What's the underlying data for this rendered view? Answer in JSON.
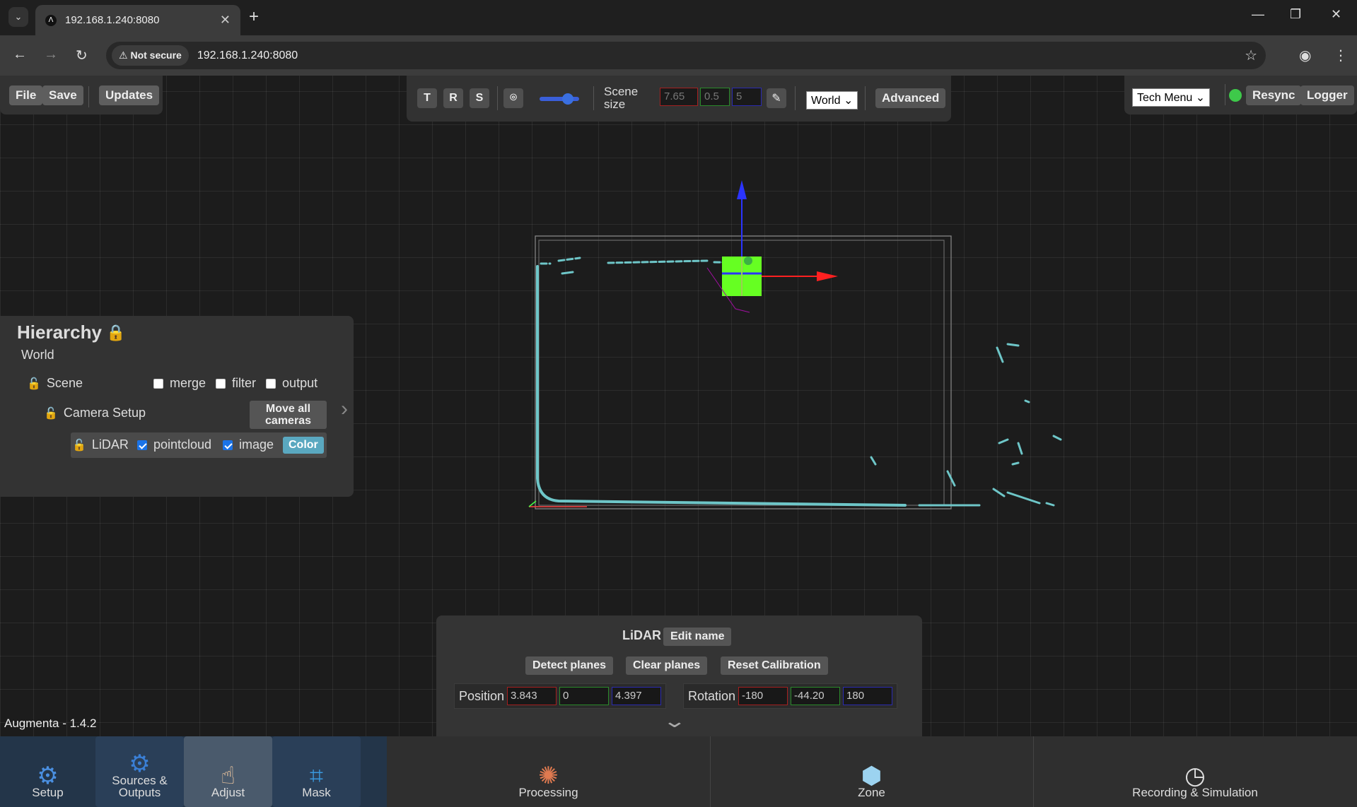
{
  "browser": {
    "tab_title": "192.168.1.240:8080",
    "not_secure": "Not secure",
    "url": "192.168.1.240:8080"
  },
  "toolbar_left": {
    "file": "File",
    "save": "Save",
    "updates": "Updates"
  },
  "toolbar_center": {
    "t": "T",
    "r": "R",
    "s": "S",
    "slider_value": 0.7,
    "scene_size_label": "Scene size",
    "scene_x": "7.65",
    "scene_y": "0.5",
    "scene_z": "5",
    "space_select": "World",
    "advanced": "Advanced"
  },
  "toolbar_right": {
    "tech_menu": "Tech Menu",
    "resync": "Resync",
    "logger": "Logger",
    "status_color": "#3ec94a"
  },
  "hierarchy": {
    "title": "Hierarchy",
    "world": "World",
    "scene": "Scene",
    "merge": "merge",
    "filter": "filter",
    "output": "output",
    "camera_setup": "Camera Setup",
    "move_all_line1": "Move all",
    "move_all_line2": "cameras",
    "lidar": "LiDAR",
    "pointcloud": "pointcloud",
    "image": "image",
    "color": "Color"
  },
  "version": "Augmenta - 1.4.2",
  "inspector": {
    "name": "LiDAR",
    "edit_name": "Edit name",
    "detect_planes": "Detect planes",
    "clear_planes": "Clear planes",
    "reset_calibration": "Reset Calibration",
    "position_label": "Position",
    "pos_x": "3.843",
    "pos_y": "0",
    "pos_z": "4.397",
    "rotation_label": "Rotation",
    "rot_x": "-180",
    "rot_y": "-44.20",
    "rot_z": "180"
  },
  "bottom_nav": {
    "setup": "Setup",
    "sources_line1": "Sources &",
    "sources_line2": "Outputs",
    "adjust": "Adjust",
    "mask": "Mask",
    "processing": "Processing",
    "zone": "Zone",
    "recording": "Recording & Simulation"
  }
}
